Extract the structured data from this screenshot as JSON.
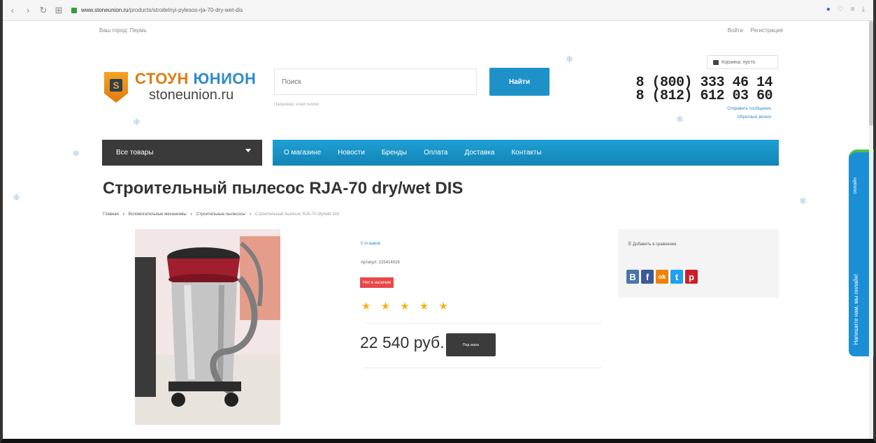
{
  "browser": {
    "url_domain": "www.stoneunion.ru",
    "url_path": "/products/stroitelnyi-pylesos-rja-70-dry-wet-dis"
  },
  "topline": {
    "city": "Ваш город: Пермь",
    "login": "Войти",
    "register": "Регистрация"
  },
  "header": {
    "logo_letter": "S",
    "logo_name_part1": "СТОУН",
    "logo_name_part2": "ЮНИОН",
    "logo_domain": "stoneunion.ru",
    "search_placeholder": "Поиск",
    "search_hint": "Например: клей ceresit",
    "search_button": "Найти",
    "cart_label": "Корзина: пусто",
    "phone1": "8 (800) 333 46 14",
    "phone2": "8 (812) 612 03 60",
    "send_message": "Отправить сообщение",
    "callback": "Обратный звонок"
  },
  "nav": {
    "catalog": "Все товары",
    "items": [
      "О магазине",
      "Новости",
      "Бренды",
      "Оплата",
      "Доставка",
      "Контакты"
    ]
  },
  "product": {
    "title": "Строительный пылесос RJA-70 dry/wet DIS",
    "breadcrumbs": [
      "Главная",
      "Вспомогательные механизмы",
      "Строительные пылесосы",
      "Строительный пылесос RJA-70 dry/wet DIS"
    ],
    "reviews": "0 отзывов",
    "article": "Артикул: 225414016",
    "stock": "Нет в наличии",
    "rating": "★ ★ ★ ★ ★",
    "price": "22 540 руб.",
    "order_button": "Под заказ"
  },
  "compare": {
    "label": "☰ Добавить в сравнение",
    "share": [
      "В",
      "f",
      "ok",
      "t",
      "p"
    ]
  },
  "chat": {
    "label": "Напишите нам, мы онлайн!",
    "top": "онлайн"
  }
}
